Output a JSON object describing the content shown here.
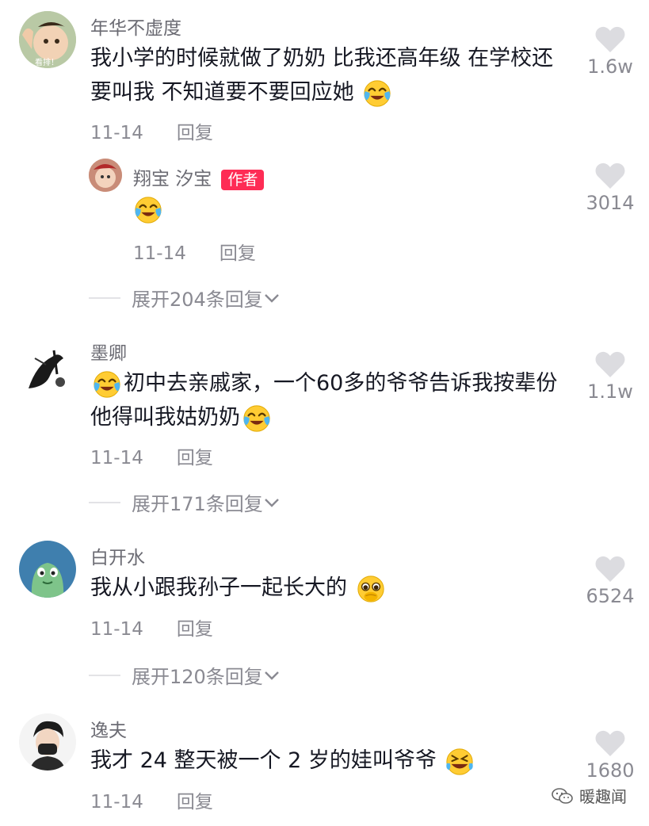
{
  "comments": [
    {
      "username": "年华不虚度",
      "text": "我小学的时候就做了奶奶 比我还高年级 在学校还要叫我 不知道要不要回应她",
      "emoji": "tears-of-joy-emoji",
      "date": "11-14",
      "reply_label": "回复",
      "likes": "1.6w",
      "avatar_text": "看排！",
      "reply": {
        "username": "翔宝 汐宝",
        "badge": "作者",
        "emoji": "tears-of-joy-emoji",
        "date": "11-14",
        "reply_label": "回复",
        "likes": "3014"
      },
      "expand_label": "展开204条回复"
    },
    {
      "username": "墨卿",
      "text_before": "初中去亲戚家，一个60多的爷爷告诉我按辈份他得叫我姑奶奶",
      "date": "11-14",
      "reply_label": "回复",
      "likes": "1.1w",
      "expand_label": "展开171条回复"
    },
    {
      "username": "白开水",
      "text": "我从小跟我孙子一起长大的",
      "emoji": "pleading-face-emoji",
      "date": "11-14",
      "reply_label": "回复",
      "likes": "6524",
      "expand_label": "展开120条回复"
    },
    {
      "username": "逸夫",
      "text": "我才 24 整天被一个 2 岁的娃叫爷爷",
      "emoji": "rofl-emoji",
      "date": "11-14",
      "reply_label": "回复",
      "likes": "1680"
    }
  ],
  "watermark": "暖趣闻",
  "colors": {
    "badge": "#fe2c55",
    "muted": "#8a8a92",
    "heart": "#dcdce0"
  }
}
